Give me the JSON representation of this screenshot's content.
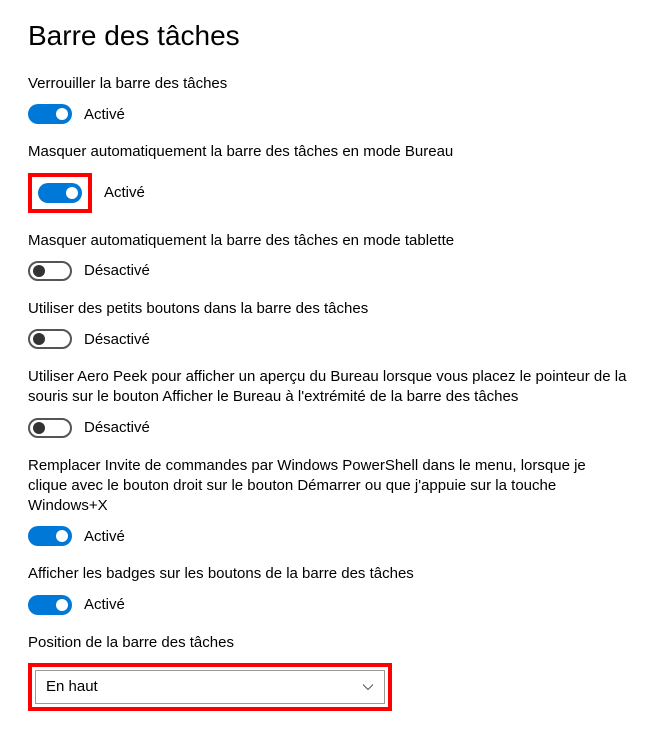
{
  "page_title": "Barre des tâches",
  "status_labels": {
    "on": "Activé",
    "off": "Désactivé"
  },
  "settings": {
    "lock": {
      "label": "Verrouiller la barre des tâches",
      "state": "on"
    },
    "autohide_desktop": {
      "label": "Masquer automatiquement la barre des tâches en mode Bureau",
      "state": "on",
      "highlighted": true
    },
    "autohide_tablet": {
      "label": "Masquer automatiquement la barre des tâches en mode tablette",
      "state": "off"
    },
    "small_buttons": {
      "label": "Utiliser des petits boutons dans la barre des tâches",
      "state": "off"
    },
    "aero_peek": {
      "label": "Utiliser Aero Peek pour afficher un aperçu du Bureau lorsque vous placez le pointeur de la souris sur le bouton Afficher le Bureau à l'extrémité de la barre des tâches",
      "state": "off"
    },
    "powershell": {
      "label": "Remplacer Invite de commandes par Windows PowerShell dans le menu, lorsque je clique avec le bouton droit sur le bouton Démarrer ou que j'appuie sur la touche Windows+X",
      "state": "on"
    },
    "badges": {
      "label": "Afficher les badges sur les boutons de la barre des tâches",
      "state": "on"
    }
  },
  "position": {
    "label": "Position de la barre des tâches",
    "value": "En haut",
    "highlighted": true
  }
}
